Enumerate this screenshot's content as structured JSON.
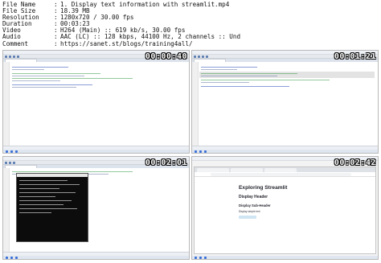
{
  "info": {
    "rows": [
      {
        "key": "File Name",
        "value": "1. Display text  information with streamlit.mp4"
      },
      {
        "key": "File Size",
        "value": "18.39 MB"
      },
      {
        "key": "Resolution",
        "value": "1280x720 / 30.00 fps"
      },
      {
        "key": "Duration",
        "value": "00:03:23"
      },
      {
        "key": "Video",
        "value": "H264 (Main) :: 619 kb/s, 30.00 fps"
      },
      {
        "key": "Audio",
        "value": "AAC (LC) :: 128 kbps, 44100 Hz, 2 channels :: Und"
      },
      {
        "key": "Comment",
        "value": "https://sanet.st/blogs/training4all/"
      }
    ],
    "separator": ":"
  },
  "thumbnails": [
    {
      "timestamp": "00:00:40",
      "content": "editor"
    },
    {
      "timestamp": "00:01:21",
      "content": "editor"
    },
    {
      "timestamp": "00:02:01",
      "content": "terminal"
    },
    {
      "timestamp": "00:02:42",
      "content": "browser"
    }
  ],
  "streamlit_page": {
    "title": "Exploring Streamlit",
    "header": "Display Header",
    "subheader": "Display Sub-Header",
    "text": "Display simple text"
  },
  "colors": {
    "timestamp_text": "#ffffff",
    "editor_bg": "#ffffff",
    "terminal_bg": "#0c0c0c",
    "streamlit_code_bg": "#cfe5f3"
  }
}
